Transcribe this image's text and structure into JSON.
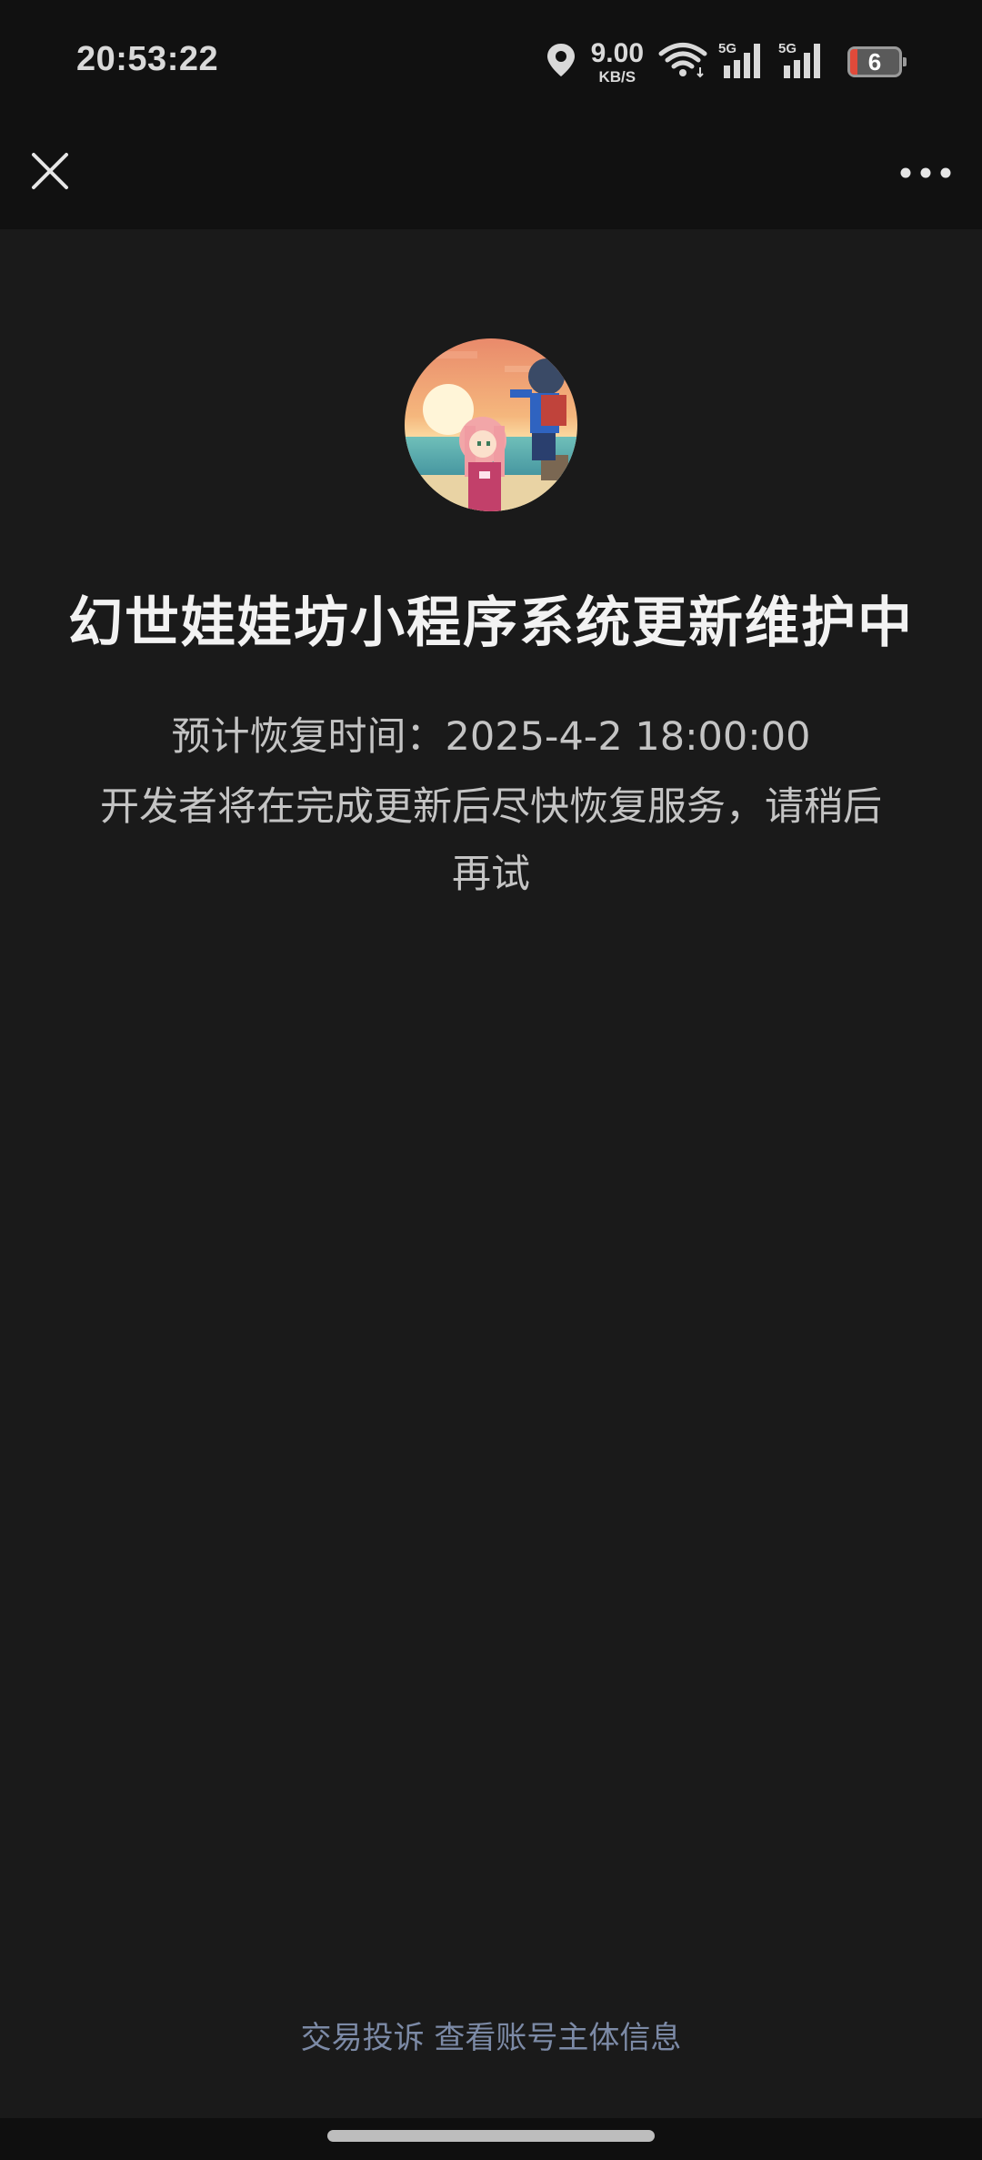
{
  "status_bar": {
    "time": "20:53:22",
    "net_speed_value": "9.00",
    "net_speed_unit": "KB/S",
    "signal1_label": "5G",
    "signal2_label": "5G",
    "battery_level": "6"
  },
  "nav": {
    "close_icon": "close-icon",
    "more_icon": "more-icon"
  },
  "main": {
    "title": "幻世娃娃坊小程序系统更新维护中",
    "recovery_time": "预计恢复时间：2025-4-2 18:00:00",
    "message": "开发者将在完成更新后尽快恢复服务，请稍后再试"
  },
  "footer": {
    "complaint_link": "交易投诉",
    "account_info_link": "查看账号主体信息"
  },
  "colors": {
    "background": "#1a1a1a",
    "bar_background": "#111111",
    "title": "#f2f2f2",
    "text": "#c4c4c4",
    "link": "#7c8aa6"
  }
}
